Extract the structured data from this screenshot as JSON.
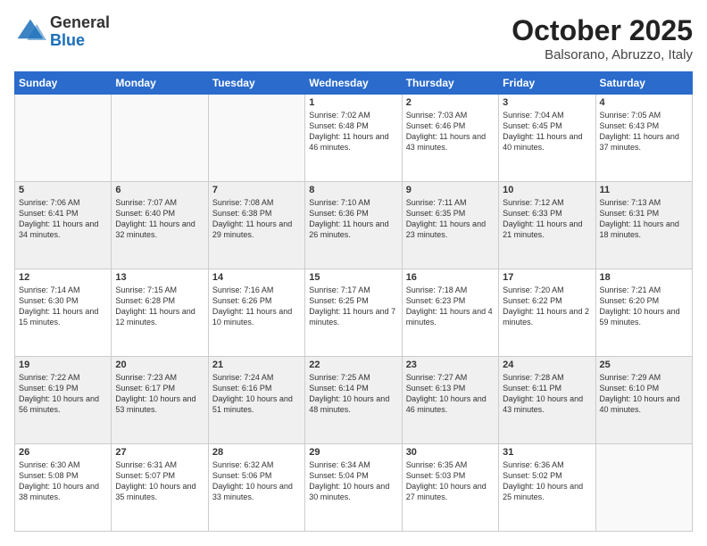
{
  "logo": {
    "general": "General",
    "blue": "Blue"
  },
  "title": "October 2025",
  "location": "Balsorano, Abruzzo, Italy",
  "weekdays": [
    "Sunday",
    "Monday",
    "Tuesday",
    "Wednesday",
    "Thursday",
    "Friday",
    "Saturday"
  ],
  "weeks": [
    [
      {
        "day": "",
        "info": ""
      },
      {
        "day": "",
        "info": ""
      },
      {
        "day": "",
        "info": ""
      },
      {
        "day": "1",
        "info": "Sunrise: 7:02 AM\nSunset: 6:48 PM\nDaylight: 11 hours and 46 minutes."
      },
      {
        "day": "2",
        "info": "Sunrise: 7:03 AM\nSunset: 6:46 PM\nDaylight: 11 hours and 43 minutes."
      },
      {
        "day": "3",
        "info": "Sunrise: 7:04 AM\nSunset: 6:45 PM\nDaylight: 11 hours and 40 minutes."
      },
      {
        "day": "4",
        "info": "Sunrise: 7:05 AM\nSunset: 6:43 PM\nDaylight: 11 hours and 37 minutes."
      }
    ],
    [
      {
        "day": "5",
        "info": "Sunrise: 7:06 AM\nSunset: 6:41 PM\nDaylight: 11 hours and 34 minutes."
      },
      {
        "day": "6",
        "info": "Sunrise: 7:07 AM\nSunset: 6:40 PM\nDaylight: 11 hours and 32 minutes."
      },
      {
        "day": "7",
        "info": "Sunrise: 7:08 AM\nSunset: 6:38 PM\nDaylight: 11 hours and 29 minutes."
      },
      {
        "day": "8",
        "info": "Sunrise: 7:10 AM\nSunset: 6:36 PM\nDaylight: 11 hours and 26 minutes."
      },
      {
        "day": "9",
        "info": "Sunrise: 7:11 AM\nSunset: 6:35 PM\nDaylight: 11 hours and 23 minutes."
      },
      {
        "day": "10",
        "info": "Sunrise: 7:12 AM\nSunset: 6:33 PM\nDaylight: 11 hours and 21 minutes."
      },
      {
        "day": "11",
        "info": "Sunrise: 7:13 AM\nSunset: 6:31 PM\nDaylight: 11 hours and 18 minutes."
      }
    ],
    [
      {
        "day": "12",
        "info": "Sunrise: 7:14 AM\nSunset: 6:30 PM\nDaylight: 11 hours and 15 minutes."
      },
      {
        "day": "13",
        "info": "Sunrise: 7:15 AM\nSunset: 6:28 PM\nDaylight: 11 hours and 12 minutes."
      },
      {
        "day": "14",
        "info": "Sunrise: 7:16 AM\nSunset: 6:26 PM\nDaylight: 11 hours and 10 minutes."
      },
      {
        "day": "15",
        "info": "Sunrise: 7:17 AM\nSunset: 6:25 PM\nDaylight: 11 hours and 7 minutes."
      },
      {
        "day": "16",
        "info": "Sunrise: 7:18 AM\nSunset: 6:23 PM\nDaylight: 11 hours and 4 minutes."
      },
      {
        "day": "17",
        "info": "Sunrise: 7:20 AM\nSunset: 6:22 PM\nDaylight: 11 hours and 2 minutes."
      },
      {
        "day": "18",
        "info": "Sunrise: 7:21 AM\nSunset: 6:20 PM\nDaylight: 10 hours and 59 minutes."
      }
    ],
    [
      {
        "day": "19",
        "info": "Sunrise: 7:22 AM\nSunset: 6:19 PM\nDaylight: 10 hours and 56 minutes."
      },
      {
        "day": "20",
        "info": "Sunrise: 7:23 AM\nSunset: 6:17 PM\nDaylight: 10 hours and 53 minutes."
      },
      {
        "day": "21",
        "info": "Sunrise: 7:24 AM\nSunset: 6:16 PM\nDaylight: 10 hours and 51 minutes."
      },
      {
        "day": "22",
        "info": "Sunrise: 7:25 AM\nSunset: 6:14 PM\nDaylight: 10 hours and 48 minutes."
      },
      {
        "day": "23",
        "info": "Sunrise: 7:27 AM\nSunset: 6:13 PM\nDaylight: 10 hours and 46 minutes."
      },
      {
        "day": "24",
        "info": "Sunrise: 7:28 AM\nSunset: 6:11 PM\nDaylight: 10 hours and 43 minutes."
      },
      {
        "day": "25",
        "info": "Sunrise: 7:29 AM\nSunset: 6:10 PM\nDaylight: 10 hours and 40 minutes."
      }
    ],
    [
      {
        "day": "26",
        "info": "Sunrise: 6:30 AM\nSunset: 5:08 PM\nDaylight: 10 hours and 38 minutes."
      },
      {
        "day": "27",
        "info": "Sunrise: 6:31 AM\nSunset: 5:07 PM\nDaylight: 10 hours and 35 minutes."
      },
      {
        "day": "28",
        "info": "Sunrise: 6:32 AM\nSunset: 5:06 PM\nDaylight: 10 hours and 33 minutes."
      },
      {
        "day": "29",
        "info": "Sunrise: 6:34 AM\nSunset: 5:04 PM\nDaylight: 10 hours and 30 minutes."
      },
      {
        "day": "30",
        "info": "Sunrise: 6:35 AM\nSunset: 5:03 PM\nDaylight: 10 hours and 27 minutes."
      },
      {
        "day": "31",
        "info": "Sunrise: 6:36 AM\nSunset: 5:02 PM\nDaylight: 10 hours and 25 minutes."
      },
      {
        "day": "",
        "info": ""
      }
    ]
  ]
}
